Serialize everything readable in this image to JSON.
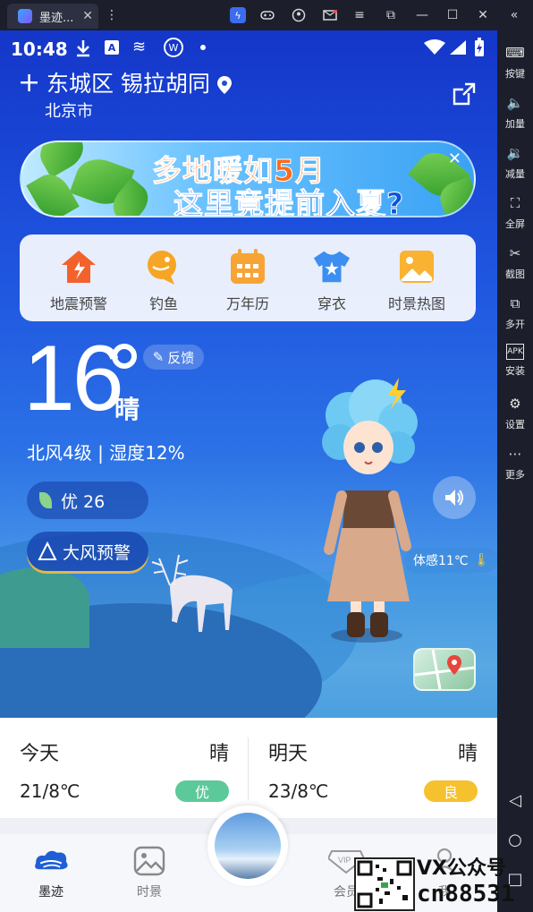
{
  "emulator": {
    "tab_title": "墨迹...",
    "toolbar": [
      {
        "label": "按键"
      },
      {
        "label": "加量"
      },
      {
        "label": "减量"
      },
      {
        "label": "全屏"
      },
      {
        "label": "截图"
      },
      {
        "label": "多开"
      },
      {
        "label": "安装"
      },
      {
        "label": "设置"
      },
      {
        "label": "更多"
      }
    ]
  },
  "status_bar": {
    "time": "10:48"
  },
  "header": {
    "district": "东城区 锡拉胡同",
    "city": "北京市"
  },
  "banner": {
    "line1": "多地暖如5月",
    "line2": "这里竟提前入夏?"
  },
  "tools": [
    {
      "label": "地震预警",
      "icon": "earthquake-house-icon"
    },
    {
      "label": "钓鱼",
      "icon": "fish-icon"
    },
    {
      "label": "万年历",
      "icon": "calendar-icon"
    },
    {
      "label": "穿衣",
      "icon": "shirt-icon"
    },
    {
      "label": "时景热图",
      "icon": "photo-icon"
    }
  ],
  "weather": {
    "temperature": "16",
    "condition": "晴",
    "feedback": "反馈",
    "wind_humidity": "北风4级 | 湿度12%",
    "aqi": "优 26",
    "warning": "大风预警",
    "feels_like": "体感11℃"
  },
  "forecast": [
    {
      "day": "今天",
      "weather": "晴",
      "range": "21/8℃",
      "aqi": "优",
      "aqi_color": "#5cc99b"
    },
    {
      "day": "明天",
      "weather": "晴",
      "range": "23/8℃",
      "aqi": "良",
      "aqi_color": "#f5c12e"
    }
  ],
  "bottom_nav": [
    {
      "label": "墨迹",
      "icon": "moji-cloud-icon"
    },
    {
      "label": "时景",
      "icon": "image-icon"
    },
    {
      "label": "会员",
      "icon": "vip-icon"
    },
    {
      "label": "我",
      "icon": "profile-icon"
    }
  ],
  "watermark": {
    "line1": "VX公众号",
    "line2": "cn88531"
  }
}
